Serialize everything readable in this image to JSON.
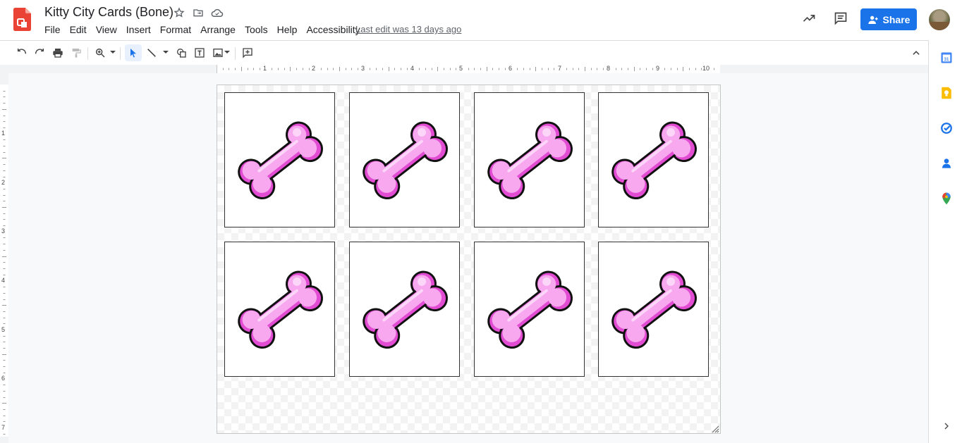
{
  "app": {
    "title": "Kitty City Cards (Bone)",
    "logo_icon": "slides-logo-icon",
    "last_edit": "Last edit was 13 days ago"
  },
  "menu": [
    "File",
    "Edit",
    "View",
    "Insert",
    "Format",
    "Arrange",
    "Tools",
    "Help",
    "Accessibility"
  ],
  "header": {
    "share_label": "Share",
    "icons": [
      "star-icon",
      "move-folder-icon",
      "cloud-status-icon",
      "activity-trend-icon",
      "comments-icon"
    ]
  },
  "toolbar": {
    "tools": [
      "undo",
      "redo",
      "print",
      "paint-format",
      "zoom",
      "select",
      "line",
      "shape",
      "text-box",
      "image",
      "comment"
    ]
  },
  "ruler": {
    "horizontal": [
      "1",
      "2",
      "3",
      "4",
      "5",
      "6",
      "7",
      "8",
      "9",
      "10"
    ],
    "vertical": [
      "1",
      "2",
      "3",
      "4",
      "5",
      "6",
      "7"
    ]
  },
  "side_panel": [
    "calendar-icon",
    "keep-icon",
    "tasks-icon",
    "contacts-icon",
    "maps-icon"
  ],
  "slide": {
    "cards": [
      {
        "image": "bone-icon",
        "color": "#f48fe8"
      },
      {
        "image": "bone-icon",
        "color": "#f48fe8"
      },
      {
        "image": "bone-icon",
        "color": "#f48fe8"
      },
      {
        "image": "bone-icon",
        "color": "#f48fe8"
      },
      {
        "image": "bone-icon",
        "color": "#f48fe8"
      },
      {
        "image": "bone-icon",
        "color": "#f48fe8"
      },
      {
        "image": "bone-icon",
        "color": "#f48fe8"
      },
      {
        "image": "bone-icon",
        "color": "#f48fe8"
      }
    ]
  },
  "colors": {
    "accent": "#1a73e8",
    "bone_fill": "#f7a8ef",
    "bone_shadow": "#e040d0"
  }
}
